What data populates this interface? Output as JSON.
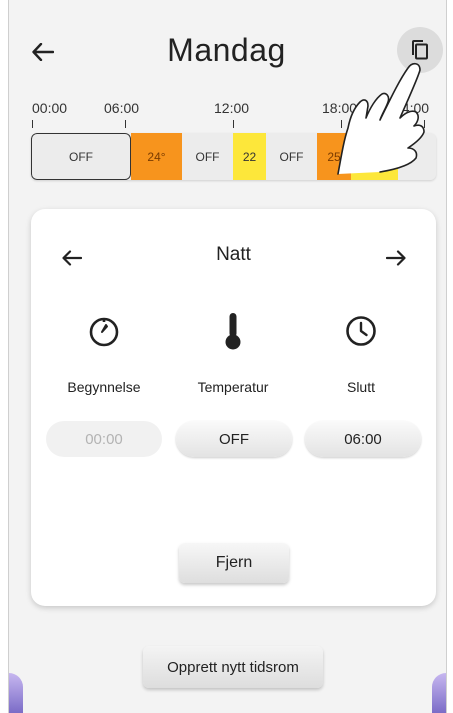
{
  "header": {
    "title": "Mandag",
    "back_icon": "arrow-left-icon",
    "copy_icon": "copy-icon"
  },
  "timeline": {
    "ticks": [
      "00:00",
      "06:00",
      "12:00",
      "18:00",
      "24:00"
    ],
    "segments": [
      {
        "label": "OFF",
        "color": "#ececec",
        "selected": true
      },
      {
        "label": "24°",
        "color": "#f7941d"
      },
      {
        "label": "OFF",
        "color": "#ececec"
      },
      {
        "label": "22",
        "color": "#fde73a"
      },
      {
        "label": "OFF",
        "color": "#ececec"
      },
      {
        "label": "25",
        "color": "#f7941d"
      },
      {
        "label": "22",
        "color": "#fde73a"
      },
      {
        "label": "",
        "color": "#ececec"
      }
    ]
  },
  "card": {
    "period_name": "Natt",
    "prev_icon": "arrow-left-icon",
    "next_icon": "arrow-right-icon",
    "start": {
      "label": "Begynnelse",
      "value": "00:00",
      "icon": "timer-icon",
      "enabled": false
    },
    "temperature": {
      "label": "Temperatur",
      "value": "OFF",
      "icon": "thermometer-icon"
    },
    "end": {
      "label": "Slutt",
      "value": "06:00",
      "icon": "clock-icon"
    },
    "remove_label": "Fjern"
  },
  "create_label": "Opprett nytt tidsrom",
  "colors": {
    "orange": "#f7941d",
    "yellow": "#fde73a",
    "background": "#f3f3f3"
  }
}
